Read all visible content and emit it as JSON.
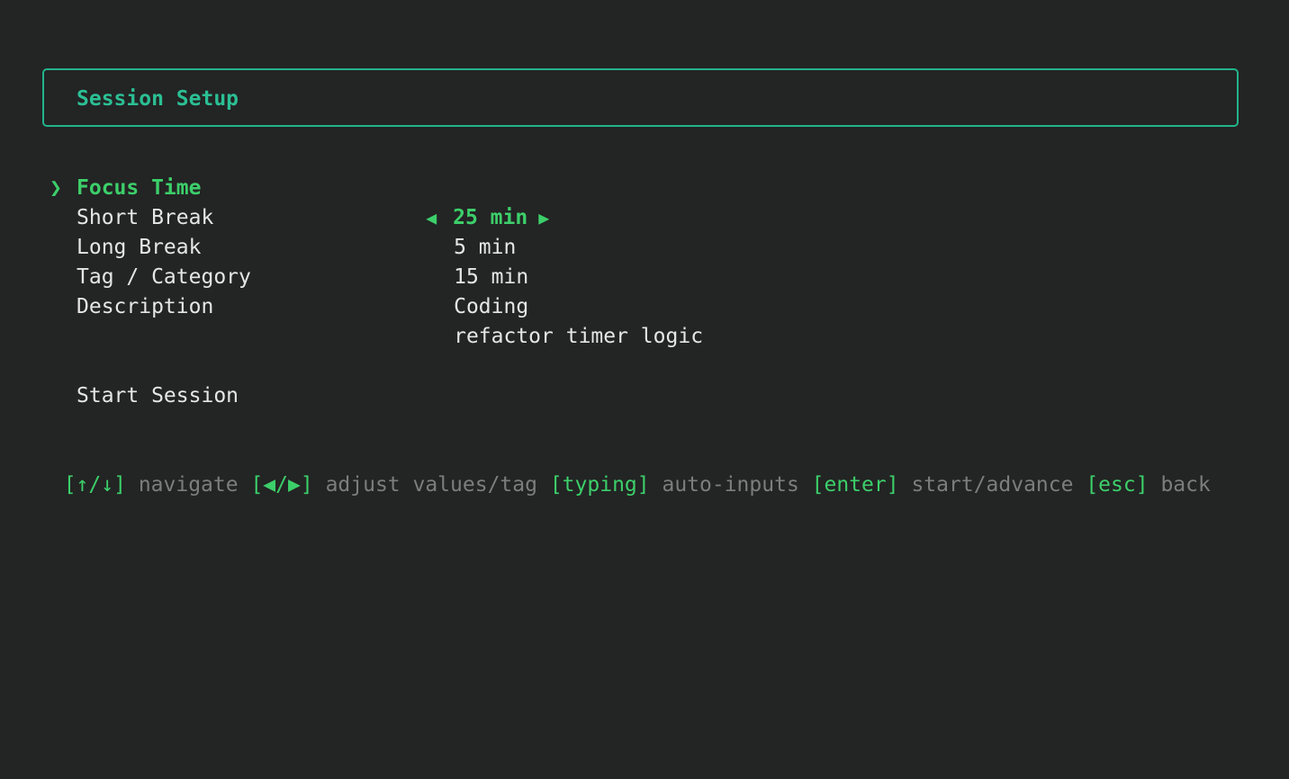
{
  "header": {
    "title": "Session Setup"
  },
  "cursor_glyph": "❯",
  "arrows": {
    "left": "◀",
    "right": "▶"
  },
  "settings": [
    {
      "label": "Focus Time",
      "value": "25 min",
      "selected": true
    },
    {
      "label": "Short Break",
      "value": "5 min",
      "selected": false
    },
    {
      "label": "Long Break",
      "value": "15 min",
      "selected": false
    },
    {
      "label": "Tag / Category",
      "value": "Coding",
      "selected": false
    },
    {
      "label": "Description",
      "value": "refactor timer logic",
      "selected": false
    }
  ],
  "start_button": {
    "label": "Start Session"
  },
  "help": [
    {
      "key": "[↑/↓]",
      "desc": "navigate"
    },
    {
      "key": "[◀/▶]",
      "desc": "adjust values/tag"
    },
    {
      "key": "[typing]",
      "desc": "auto-inputs"
    },
    {
      "key": "[enter]",
      "desc": "start/advance"
    },
    {
      "key": "[esc]",
      "desc": "back"
    }
  ],
  "colors": {
    "background": "#232424",
    "accent": "#3ccf6a",
    "border": "#22b38a",
    "text": "#e6e6e6",
    "muted": "#7d7d7d"
  }
}
